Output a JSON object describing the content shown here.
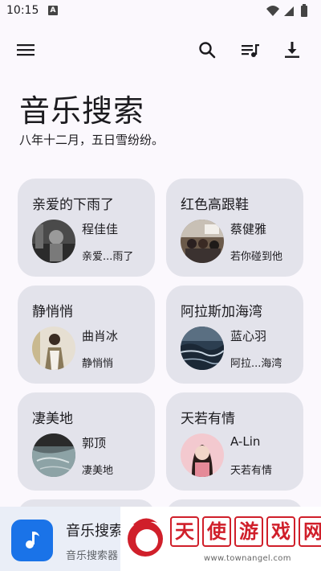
{
  "status_bar": {
    "time": "10:15",
    "notification_icon": "a-notification-icon",
    "icons": [
      "wifi-icon",
      "signal-icon",
      "battery-icon"
    ]
  },
  "app_bar": {
    "menu_icon": "hamburger-menu-icon",
    "actions": [
      "search-icon",
      "playlist-icon",
      "download-icon"
    ]
  },
  "page": {
    "title": "音乐搜索",
    "subtitle": "八年十二月，五日雪纷纷。"
  },
  "cards": [
    {
      "title": "亲爱的下雨了",
      "artist": "程佳佳",
      "album": "亲爱...雨了"
    },
    {
      "title": "红色高跟鞋",
      "artist": "蔡健雅",
      "album": "若你碰到他"
    },
    {
      "title": "静悄悄",
      "artist": "曲肖冰",
      "album": "静悄悄"
    },
    {
      "title": "阿拉斯加海湾",
      "artist": "蓝心羽",
      "album": "阿拉...海湾"
    },
    {
      "title": "凄美地",
      "artist": "郭顶",
      "album": "凄美地"
    },
    {
      "title": "天若有情",
      "artist": "A-Lin",
      "album": "天若有情"
    }
  ],
  "bottom_bar": {
    "icon": "music-note-icon",
    "title": "音乐搜索",
    "subtitle": "音乐搜索器",
    "accent_color": "#1a73e8"
  },
  "watermark": {
    "chars": [
      "天",
      "使",
      "游",
      "戏",
      "网"
    ],
    "url": "www.townangel.com"
  }
}
